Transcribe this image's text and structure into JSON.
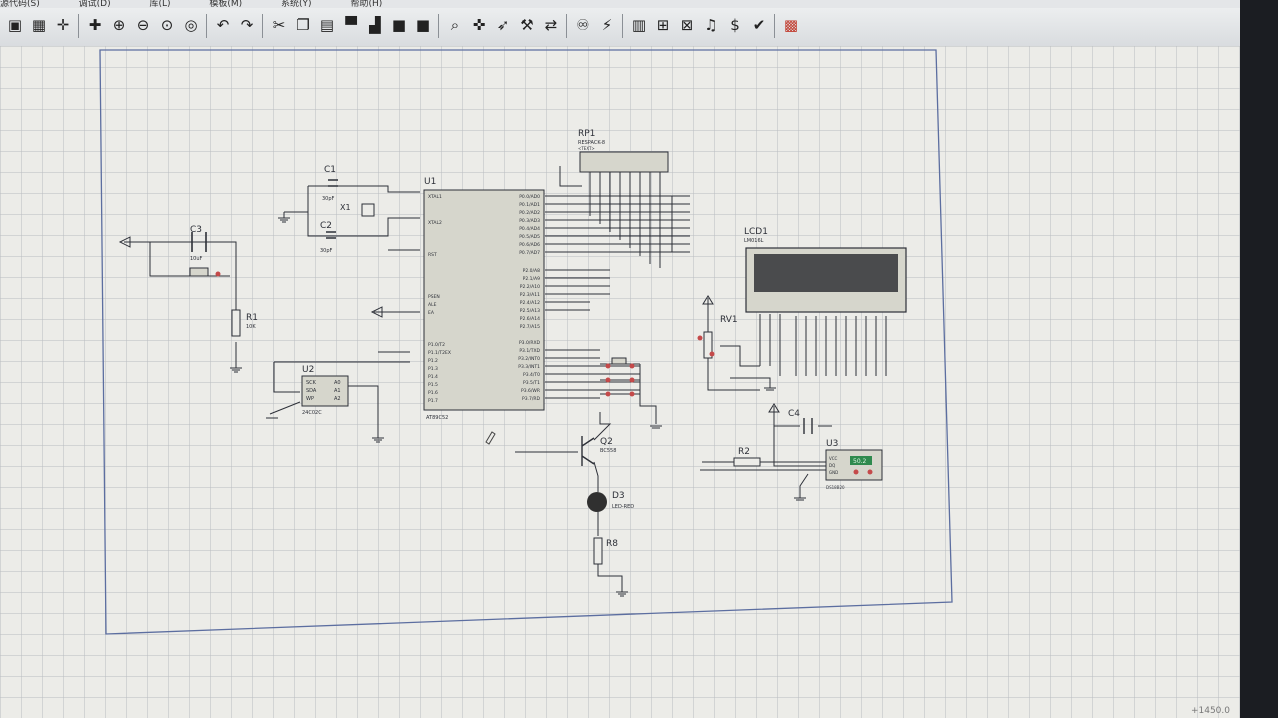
{
  "menu": {
    "items": [
      "源代码(S)",
      "调试(D)",
      "库(L)",
      "模板(M)",
      "系统(Y)",
      "帮助(H)"
    ]
  },
  "toolbar": {
    "buttons": [
      {
        "name": "new-sheet",
        "icon": "sheet-icon",
        "glyph": "▣"
      },
      {
        "name": "grid-toggle",
        "icon": "grid-icon",
        "glyph": "▦"
      },
      {
        "name": "origin",
        "icon": "origin-icon",
        "glyph": "✛"
      },
      {
        "name": "pan",
        "icon": "pan-icon",
        "glyph": "✚"
      },
      {
        "name": "zoom-in",
        "icon": "zoom-in-icon",
        "glyph": "⊕"
      },
      {
        "name": "zoom-out",
        "icon": "zoom-out-icon",
        "glyph": "⊖"
      },
      {
        "name": "zoom-all",
        "icon": "zoom-all-icon",
        "glyph": "⊙"
      },
      {
        "name": "zoom-area",
        "icon": "zoom-area-icon",
        "glyph": "◎"
      },
      {
        "name": "undo",
        "icon": "undo-icon",
        "glyph": "↶"
      },
      {
        "name": "redo",
        "icon": "redo-icon",
        "glyph": "↷"
      },
      {
        "name": "cut",
        "icon": "cut-icon",
        "glyph": "✂"
      },
      {
        "name": "copy",
        "icon": "copy-icon",
        "glyph": "❐"
      },
      {
        "name": "paste",
        "icon": "paste-icon",
        "glyph": "▤"
      },
      {
        "name": "block-copy",
        "icon": "block-copy-icon",
        "glyph": "▀"
      },
      {
        "name": "block-move",
        "icon": "block-move-icon",
        "glyph": "▟"
      },
      {
        "name": "block-rotate",
        "icon": "block-rotate-icon",
        "glyph": "■"
      },
      {
        "name": "block-delete",
        "icon": "block-delete-icon",
        "glyph": "■"
      },
      {
        "name": "pick-device",
        "icon": "pick-device-icon",
        "glyph": "⌕"
      },
      {
        "name": "make-device",
        "icon": "make-device-icon",
        "glyph": "✜"
      },
      {
        "name": "package",
        "icon": "package-icon",
        "glyph": "➶"
      },
      {
        "name": "decompose",
        "icon": "hammer-icon",
        "glyph": "⚒"
      },
      {
        "name": "wire-autorouter",
        "icon": "autorouter-icon",
        "glyph": "⇄"
      },
      {
        "name": "search",
        "icon": "binoculars-icon",
        "glyph": "♾"
      },
      {
        "name": "property-assign",
        "icon": "property-icon",
        "glyph": "⚡"
      },
      {
        "name": "new-sheet-2",
        "icon": "new-sheet-icon",
        "glyph": "▥"
      },
      {
        "name": "add-sheet",
        "icon": "add-sheet-icon",
        "glyph": "⊞"
      },
      {
        "name": "remove-sheet",
        "icon": "remove-sheet-icon",
        "glyph": "⊠"
      },
      {
        "name": "netlist",
        "icon": "netlist-icon",
        "glyph": "♫"
      },
      {
        "name": "bill-of-materials",
        "icon": "bom-icon",
        "glyph": "$"
      },
      {
        "name": "electrical-check",
        "icon": "check-icon",
        "glyph": "✔"
      },
      {
        "name": "ares",
        "icon": "ares-icon",
        "glyph": "▩"
      }
    ]
  },
  "schematic": {
    "components": {
      "c1": {
        "ref": "C1",
        "value": "30pF"
      },
      "c2": {
        "ref": "C2",
        "value": "30pF"
      },
      "c3": {
        "ref": "C3",
        "value": "10uF"
      },
      "c4": {
        "ref": "C4"
      },
      "x1": {
        "ref": "X1"
      },
      "r1": {
        "ref": "R1",
        "value": "10K"
      },
      "r2": {
        "ref": "R2"
      },
      "r8": {
        "ref": "R8"
      },
      "u1": {
        "ref": "U1",
        "part": "AT89C52"
      },
      "u2": {
        "ref": "U2",
        "part": "24C02C"
      },
      "u3": {
        "ref": "U3",
        "part": "DS18B20",
        "readout": "50.2"
      },
      "rp1": {
        "ref": "RP1",
        "part": "RESPACK-8"
      },
      "lcd1": {
        "ref": "LCD1",
        "part": "LM016L"
      },
      "rv1": {
        "ref": "RV1"
      },
      "q2": {
        "ref": "Q2",
        "part": "BC558"
      },
      "d3": {
        "ref": "D3",
        "part": "LED-RED"
      }
    },
    "text_placeholder": "<TEXT>",
    "u1_left_pins": [
      "XTAL1",
      "XTAL2",
      "RST",
      "PSEN",
      "ALE",
      "EA",
      "P1.0/T2",
      "P1.1/T2EX",
      "P1.2",
      "P1.3",
      "P1.4",
      "P1.5",
      "P1.6",
      "P1.7"
    ],
    "u1_right_pins": [
      "P0.0/AD0",
      "P0.1/AD1",
      "P0.2/AD2",
      "P0.3/AD3",
      "P0.4/AD4",
      "P0.5/AD5",
      "P0.6/AD6",
      "P0.7/AD7",
      "P2.0/A8",
      "P2.1/A9",
      "P2.2/A10",
      "P2.3/A11",
      "P2.4/A12",
      "P2.5/A13",
      "P2.6/A14",
      "P2.7/A15",
      "P3.0/RXD",
      "P3.1/TXD",
      "P3.2/INT0",
      "P3.3/INT1",
      "P3.4/T0",
      "P3.5/T1",
      "P3.6/WR",
      "P3.7/RD"
    ],
    "u2_pins": [
      "SCK",
      "SDA",
      "WP",
      "A0",
      "A1",
      "A2"
    ],
    "u3_pins": [
      "VCC",
      "DQ",
      "GND"
    ]
  },
  "colors": {
    "sheet_bg": "#ecece8",
    "grid": "#b9bcc0",
    "wire": "#2d3038",
    "component_fill": "#d6d6cc",
    "lcd_screen": "#4a4b4d",
    "pin_red": "#c44a4a",
    "led_fill": "#303030",
    "display_green": "#2f8a4e"
  },
  "status": {
    "coords": "+1450.0"
  }
}
